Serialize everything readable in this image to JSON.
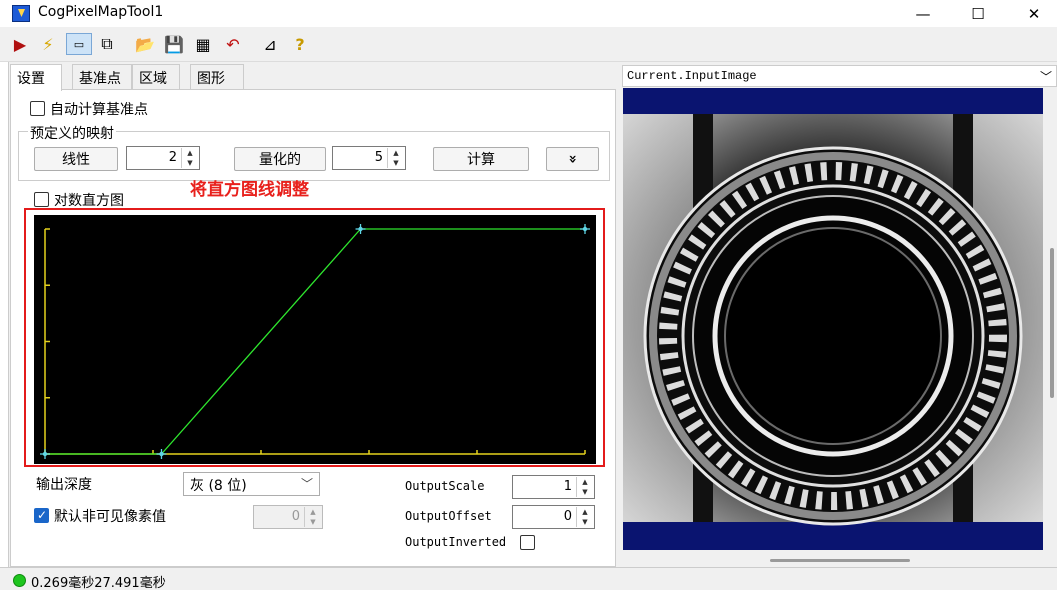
{
  "window": {
    "title": "CogPixelMapTool1"
  },
  "tabs": [
    "设置",
    "基准点",
    "区域",
    "图形"
  ],
  "settings": {
    "auto_ref_label": "自动计算基准点",
    "predefined_label": "预定义的映射",
    "linear_button": "线性",
    "linear_value": "2",
    "quantized_button": "量化的",
    "quantized_value": "5",
    "compute_button": "计算",
    "expand_button": "»",
    "log_hist_label": "对数直方图",
    "annotation": "将直方图线调整",
    "output_depth_label": "输出深度",
    "output_depth_value": "灰 (8 位)",
    "default_invisible_label": "默认非可见像素值",
    "default_invisible_value": "0",
    "output_scale_label": "OutputScale",
    "output_scale_value": "1",
    "output_offset_label": "OutputOffset",
    "output_offset_value": "0",
    "output_inverted_label": "OutputInverted"
  },
  "viewer": {
    "combo_text": "Current.InputImage"
  },
  "status": {
    "text": "0.269毫秒27.491毫秒"
  },
  "colors": {
    "curve": "#2ee62e",
    "axis": "#e6d21e",
    "handle": "#5fd6e6",
    "annotation": "#e8201c",
    "image_bg": "#0a1470"
  },
  "chart_data": {
    "type": "line",
    "x": [
      0,
      55,
      149,
      255
    ],
    "y": [
      0,
      0,
      255,
      255
    ],
    "xlim": [
      0,
      255
    ],
    "ylim": [
      0,
      255
    ]
  }
}
